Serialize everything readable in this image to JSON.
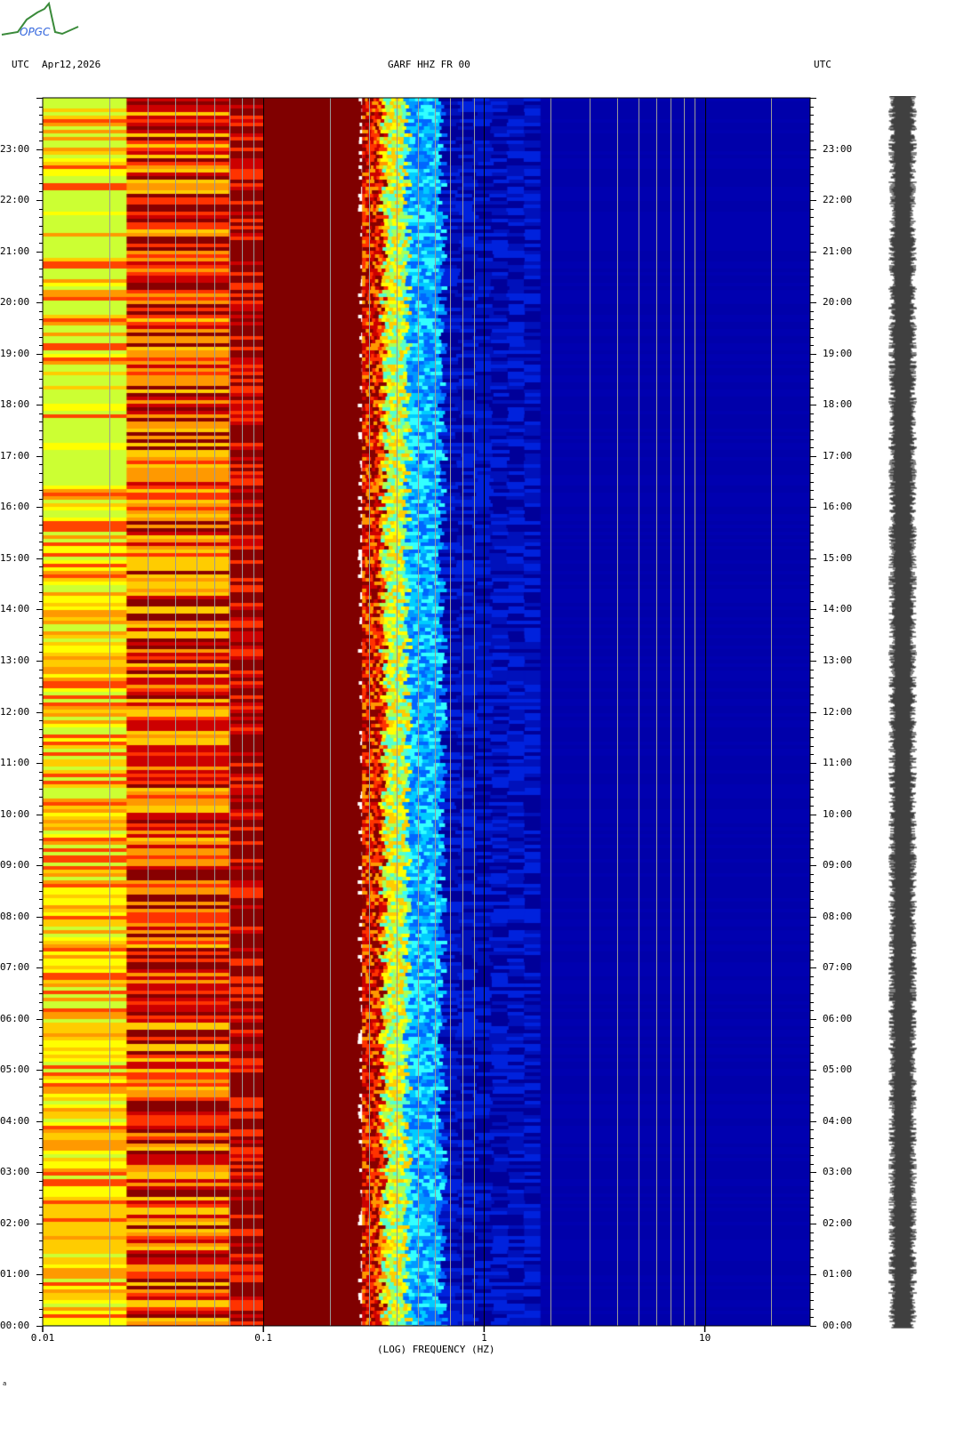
{
  "header": {
    "left_tz": "UTC",
    "date": "Apr12,2026",
    "station": "GARF HHZ FR 00",
    "right_tz": "UTC",
    "logo_text": "OPGC"
  },
  "footer_mark": "a",
  "chart_data": {
    "type": "heatmap",
    "title": "GARF HHZ FR 00",
    "xlabel": "(LOG) FREQUENCY (HZ)",
    "xscale": "log",
    "xlim": [
      0.01,
      30
    ],
    "xticks": [
      {
        "v": 0.01,
        "label": "0.01"
      },
      {
        "v": 0.1,
        "label": "0.1"
      },
      {
        "v": 1,
        "label": "1"
      },
      {
        "v": 10,
        "label": "10"
      }
    ],
    "ylabel": "UTC",
    "ylim_hours": [
      0,
      24
    ],
    "yticks": [
      "00:00",
      "01:00",
      "02:00",
      "03:00",
      "04:00",
      "05:00",
      "06:00",
      "07:00",
      "08:00",
      "09:00",
      "10:00",
      "11:00",
      "12:00",
      "13:00",
      "14:00",
      "15:00",
      "16:00",
      "17:00",
      "18:00",
      "19:00",
      "20:00",
      "21:00",
      "22:00",
      "23:00"
    ],
    "grid": true,
    "bands": [
      {
        "fmin": 0.01,
        "fmax": 0.024,
        "palette": [
          "#ffff00",
          "#ffcc00",
          "#ff9900",
          "#ff4400",
          "#ccff33"
        ]
      },
      {
        "fmin": 0.024,
        "fmax": 0.07,
        "palette": [
          "#cc0000",
          "#ff3300",
          "#ff9900",
          "#ffcc00",
          "#880000"
        ]
      },
      {
        "fmin": 0.07,
        "fmax": 0.1,
        "palette": [
          "#880000",
          "#880000",
          "#cc0000",
          "#ff3300"
        ]
      },
      {
        "fmin": 0.1,
        "fmax": 0.28,
        "palette": [
          "#800000"
        ]
      },
      {
        "fmin": 0.28,
        "fmax": 0.35,
        "palette": [
          "#cc0000",
          "#ff3300",
          "#ff9900",
          "#880000"
        ]
      },
      {
        "fmin": 0.35,
        "fmax": 0.45,
        "palette": [
          "#ffff00",
          "#ffcc00",
          "#aaff55",
          "#55ffcc"
        ]
      },
      {
        "fmin": 0.45,
        "fmax": 0.65,
        "palette": [
          "#00ccff",
          "#0099ff",
          "#0066ff",
          "#33ffff"
        ]
      },
      {
        "fmin": 0.65,
        "fmax": 1.8,
        "palette": [
          "#0022dd",
          "#0011bb",
          "#000099"
        ]
      },
      {
        "fmin": 1.8,
        "fmax": 30,
        "palette": [
          "#0000aa",
          "#0000b0"
        ]
      }
    ]
  }
}
